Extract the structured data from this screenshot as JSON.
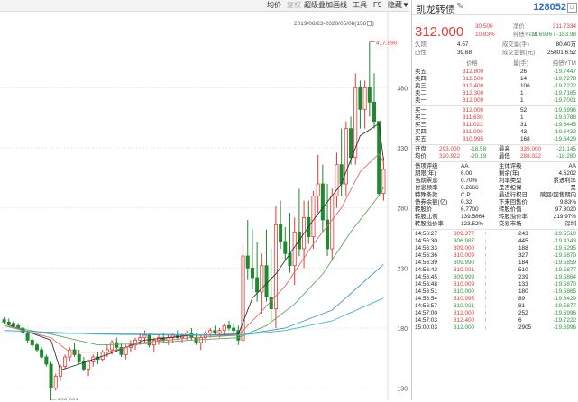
{
  "toolbar": {
    "items": [
      {
        "label": "均价",
        "disabled": false
      },
      {
        "label": "复权",
        "disabled": true
      },
      {
        "label": "超级叠加",
        "disabled": false
      },
      {
        "label": "画线",
        "disabled": false
      },
      {
        "label": "工具",
        "disabled": false
      },
      {
        "label": "F9",
        "disabled": false
      },
      {
        "label": "隐藏▼",
        "disabled": false
      }
    ]
  },
  "chart": {
    "date_range": "2019/08/23-2020/05/08(158日)",
    "high_label": "417.990",
    "low_label": "120.001",
    "y_ticks": [
      "380",
      "330",
      "280",
      "230",
      "180",
      "130"
    ],
    "colors": {
      "up": "#e53935",
      "down": "#1e8a2e",
      "ma1": "#333333",
      "ma2": "#e06c6c",
      "ma3": "#5aaa5a",
      "ma4": "#4a90c8",
      "ma5": "#3dbdbd"
    }
  },
  "chart_data": {
    "type": "candlestick",
    "ylim": [
      120,
      420
    ],
    "candles": [
      [
        187,
        189,
        183,
        185
      ],
      [
        185,
        188,
        182,
        184
      ],
      [
        184,
        186,
        181,
        182
      ],
      [
        182,
        184,
        179,
        180
      ],
      [
        180,
        181,
        175,
        176
      ],
      [
        176,
        178,
        168,
        170
      ],
      [
        170,
        172,
        164,
        166
      ],
      [
        166,
        168,
        160,
        162
      ],
      [
        162,
        164,
        155,
        156
      ],
      [
        156,
        158,
        148,
        150
      ],
      [
        150,
        152,
        120,
        130
      ],
      [
        130,
        142,
        128,
        140
      ],
      [
        140,
        150,
        136,
        148
      ],
      [
        148,
        158,
        146,
        156
      ],
      [
        156,
        164,
        152,
        162
      ],
      [
        162,
        168,
        156,
        158
      ],
      [
        158,
        162,
        150,
        152
      ],
      [
        152,
        156,
        144,
        146
      ],
      [
        146,
        154,
        140,
        152
      ],
      [
        152,
        158,
        148,
        156
      ],
      [
        156,
        160,
        150,
        154
      ],
      [
        154,
        162,
        152,
        160
      ],
      [
        160,
        166,
        156,
        162
      ],
      [
        162,
        170,
        158,
        168
      ],
      [
        168,
        172,
        160,
        164
      ],
      [
        164,
        168,
        156,
        158
      ],
      [
        158,
        166,
        154,
        164
      ],
      [
        164,
        170,
        160,
        166
      ],
      [
        166,
        172,
        162,
        170
      ],
      [
        170,
        176,
        166,
        172
      ],
      [
        172,
        178,
        168,
        174
      ],
      [
        174,
        176,
        164,
        166
      ],
      [
        166,
        172,
        160,
        170
      ],
      [
        170,
        174,
        166,
        172
      ],
      [
        172,
        176,
        168,
        170
      ],
      [
        170,
        174,
        166,
        172
      ],
      [
        172,
        176,
        168,
        174
      ],
      [
        174,
        178,
        170,
        172
      ],
      [
        172,
        176,
        168,
        174
      ],
      [
        174,
        178,
        170,
        176
      ],
      [
        176,
        180,
        170,
        172
      ],
      [
        172,
        176,
        166,
        168
      ],
      [
        168,
        174,
        162,
        172
      ],
      [
        172,
        178,
        168,
        176
      ],
      [
        176,
        180,
        172,
        178
      ],
      [
        178,
        182,
        174,
        176
      ],
      [
        176,
        180,
        172,
        178
      ],
      [
        178,
        184,
        174,
        182
      ],
      [
        182,
        186,
        178,
        180
      ],
      [
        180,
        184,
        176,
        178
      ],
      [
        178,
        182,
        166,
        170
      ],
      [
        170,
        250,
        168,
        240
      ],
      [
        240,
        270,
        220,
        230
      ],
      [
        230,
        262,
        212,
        222
      ],
      [
        222,
        252,
        202,
        210
      ],
      [
        210,
        242,
        192,
        232
      ],
      [
        232,
        262,
        202,
        206
      ],
      [
        206,
        246,
        186,
        196
      ],
      [
        196,
        282,
        180,
        266
      ],
      [
        266,
        286,
        246,
        252
      ],
      [
        252,
        264,
        236,
        242
      ],
      [
        242,
        276,
        226,
        232
      ],
      [
        232,
        272,
        216,
        260
      ],
      [
        260,
        296,
        240,
        246
      ],
      [
        246,
        286,
        230,
        272
      ],
      [
        272,
        286,
        250,
        256
      ],
      [
        256,
        294,
        246,
        290
      ],
      [
        290,
        324,
        276,
        300
      ],
      [
        300,
        316,
        260,
        270
      ],
      [
        270,
        300,
        240,
        246
      ],
      [
        246,
        296,
        236,
        290
      ],
      [
        290,
        326,
        280,
        316
      ],
      [
        316,
        346,
        290,
        300
      ],
      [
        300,
        352,
        290,
        346
      ],
      [
        346,
        356,
        316,
        322
      ],
      [
        322,
        392,
        316,
        380
      ],
      [
        380,
        386,
        346,
        362
      ],
      [
        362,
        386,
        346,
        380
      ],
      [
        380,
        418,
        356,
        368
      ],
      [
        368,
        392,
        346,
        352
      ],
      [
        352,
        334,
        290,
        292
      ],
      [
        292,
        322,
        286,
        312
      ]
    ],
    "ma": [
      {
        "name": "MA5",
        "color": "#333333",
        "points": [
          [
            0,
            184
          ],
          [
            10,
            170
          ],
          [
            12,
            145
          ],
          [
            16,
            150
          ],
          [
            22,
            158
          ],
          [
            30,
            170
          ],
          [
            40,
            174
          ],
          [
            50,
            175
          ],
          [
            53,
            205
          ],
          [
            58,
            225
          ],
          [
            66,
            270
          ],
          [
            72,
            300
          ],
          [
            76,
            340
          ],
          [
            80,
            350
          ],
          [
            81,
            320
          ]
        ]
      },
      {
        "name": "MA10",
        "color": "#e06c6c",
        "points": [
          [
            0,
            182
          ],
          [
            10,
            172
          ],
          [
            14,
            160
          ],
          [
            22,
            160
          ],
          [
            30,
            168
          ],
          [
            40,
            172
          ],
          [
            50,
            174
          ],
          [
            54,
            190
          ],
          [
            60,
            215
          ],
          [
            66,
            250
          ],
          [
            72,
            280
          ],
          [
            76,
            310
          ],
          [
            80,
            325
          ],
          [
            81,
            318
          ]
        ]
      },
      {
        "name": "MA20",
        "color": "#5aaa5a",
        "points": [
          [
            0,
            182
          ],
          [
            10,
            175
          ],
          [
            20,
            166
          ],
          [
            30,
            167
          ],
          [
            40,
            170
          ],
          [
            50,
            172
          ],
          [
            56,
            182
          ],
          [
            62,
            200
          ],
          [
            68,
            225
          ],
          [
            74,
            260
          ],
          [
            80,
            290
          ],
          [
            81,
            297
          ]
        ]
      },
      {
        "name": "MA60",
        "color": "#4a90c8",
        "points": [
          [
            0,
            178
          ],
          [
            20,
            175
          ],
          [
            40,
            174
          ],
          [
            50,
            174
          ],
          [
            60,
            180
          ],
          [
            70,
            195
          ],
          [
            81,
            233
          ]
        ]
      },
      {
        "name": "MA120",
        "color": "#3dbdbd",
        "points": [
          [
            0,
            176
          ],
          [
            30,
            175
          ],
          [
            50,
            174
          ],
          [
            60,
            178
          ],
          [
            70,
            186
          ],
          [
            81,
            205
          ]
        ]
      }
    ]
  },
  "quote": {
    "name": "凯龙转债",
    "edit_icon": "edit-icon",
    "code": "128052",
    "price": "312.000",
    "info_rows": [
      [
        "30.500",
        "净价",
        "311.7334"
      ],
      [
        "10.83%",
        "纯债YTM",
        "-19.6996 / -183.98"
      ]
    ],
    "top_rows": [
      {
        "l": "久期",
        "v": "4.57",
        "l2": "成交量(手)",
        "v2": "80.40万"
      },
      {
        "l": "凸性",
        "v": "39.68",
        "l2": "成交金额(元)",
        "v2": "25801.6.52"
      }
    ],
    "book_header": [
      "价格",
      "量(手)",
      "纯债YTM"
    ],
    "asks": [
      {
        "label": "卖五",
        "price": "312.800",
        "vol": "26",
        "ytm": "-19.7447"
      },
      {
        "label": "卖四",
        "price": "312.500",
        "vol": "14",
        "ytm": "-19.7278"
      },
      {
        "label": "卖三",
        "price": "312.400",
        "vol": "106",
        "ytm": "-19.7222"
      },
      {
        "label": "卖二",
        "price": "312.300",
        "vol": "1",
        "ytm": "-19.7165"
      },
      {
        "label": "卖一",
        "price": "312.009",
        "vol": "1",
        "ytm": "-19.7001"
      }
    ],
    "bids": [
      {
        "label": "买一",
        "price": "312.000",
        "vol": "52",
        "ytm": "-19.6996"
      },
      {
        "label": "买二",
        "price": "311.630",
        "vol": "1",
        "ytm": "-19.6788"
      },
      {
        "label": "买三",
        "price": "311.023",
        "vol": "31",
        "ytm": "-19.6445"
      },
      {
        "label": "买四",
        "price": "311.000",
        "vol": "43",
        "ytm": "-19.6432"
      },
      {
        "label": "买五",
        "price": "310.995",
        "vol": "168",
        "ytm": "-19.6429"
      }
    ],
    "ohlc": [
      {
        "l": "开盘",
        "v": "293.000",
        "d": "-18.58",
        "l2": "最高",
        "v2": "339.000",
        "d2": "-21.145"
      },
      {
        "l": "均价",
        "v": "320.922",
        "d": "-20.19",
        "l2": "最低",
        "v2": "288.022",
        "d2": "-18.280"
      }
    ],
    "stats": [
      [
        "债项评级",
        "AA",
        "主体评级",
        "AA"
      ],
      [
        "期限(年)",
        "6.00",
        "剩余(年)",
        "4.6202"
      ],
      [
        "当期票息",
        "0.70%",
        "利率类型",
        "累进利率"
      ],
      [
        "付息频率",
        "0.2666",
        "是否担保",
        "是"
      ],
      [
        "特殊条款",
        "C,P",
        "最近行权日",
        "赎回/回售期内"
      ],
      [
        "债券余额(亿)",
        "0.32",
        "下来回售价",
        "9.83%"
      ],
      [
        "转股价",
        "6.7700",
        "转股价值",
        "97.3020"
      ],
      [
        "转股比例",
        "139.5864",
        "转股溢价率",
        "219.97%"
      ],
      [
        "转股溢价率",
        "123.52%",
        "交易市场",
        "深圳"
      ]
    ],
    "trades": [
      {
        "time": "14:56:27",
        "price": "309.377",
        "arrow": "↑",
        "vol": "243",
        "ytm": "-19.5510"
      },
      {
        "time": "14:56:30",
        "price": "306.987",
        "arrow": "↓",
        "vol": "445",
        "ytm": "-19.4143"
      },
      {
        "time": "14:56:33",
        "price": "309.000",
        "arrow": "↑",
        "vol": "188",
        "ytm": "-19.5295"
      },
      {
        "time": "14:56:36",
        "price": "310.009",
        "arrow": "↑",
        "vol": "327",
        "ytm": "-19.5870"
      },
      {
        "time": "14:56:39",
        "price": "309.990",
        "arrow": "↓",
        "vol": "184",
        "ytm": "-19.5859"
      },
      {
        "time": "14:56:42",
        "price": "310.021",
        "arrow": "↑",
        "vol": "510",
        "ytm": "-19.5877"
      },
      {
        "time": "14:56:45",
        "price": "309.999",
        "arrow": "↓",
        "vol": "239",
        "ytm": "-19.5864"
      },
      {
        "time": "14:56:48",
        "price": "310.009",
        "arrow": "↑",
        "vol": "133",
        "ytm": "-19.5870"
      },
      {
        "time": "14:56:51",
        "price": "310.000",
        "arrow": "↓",
        "vol": "180",
        "ytm": "-19.5865"
      },
      {
        "time": "14:56:54",
        "price": "310.995",
        "arrow": "↑",
        "vol": "89",
        "ytm": "-19.6429"
      },
      {
        "time": "14:56:57",
        "price": "310.021",
        "arrow": "↓",
        "vol": "81",
        "ytm": "-19.5877"
      },
      {
        "time": "14:57:00",
        "price": "312.000",
        "arrow": "↑",
        "vol": "252",
        "ytm": "-19.6996"
      },
      {
        "time": "14:57:03",
        "price": "312.400",
        "arrow": "↑",
        "vol": "6",
        "ytm": "-19.7222"
      },
      {
        "time": "15:00:03",
        "price": "312.000",
        "arrow": "↓",
        "vol": "2905",
        "ytm": "-19.6996"
      }
    ]
  }
}
